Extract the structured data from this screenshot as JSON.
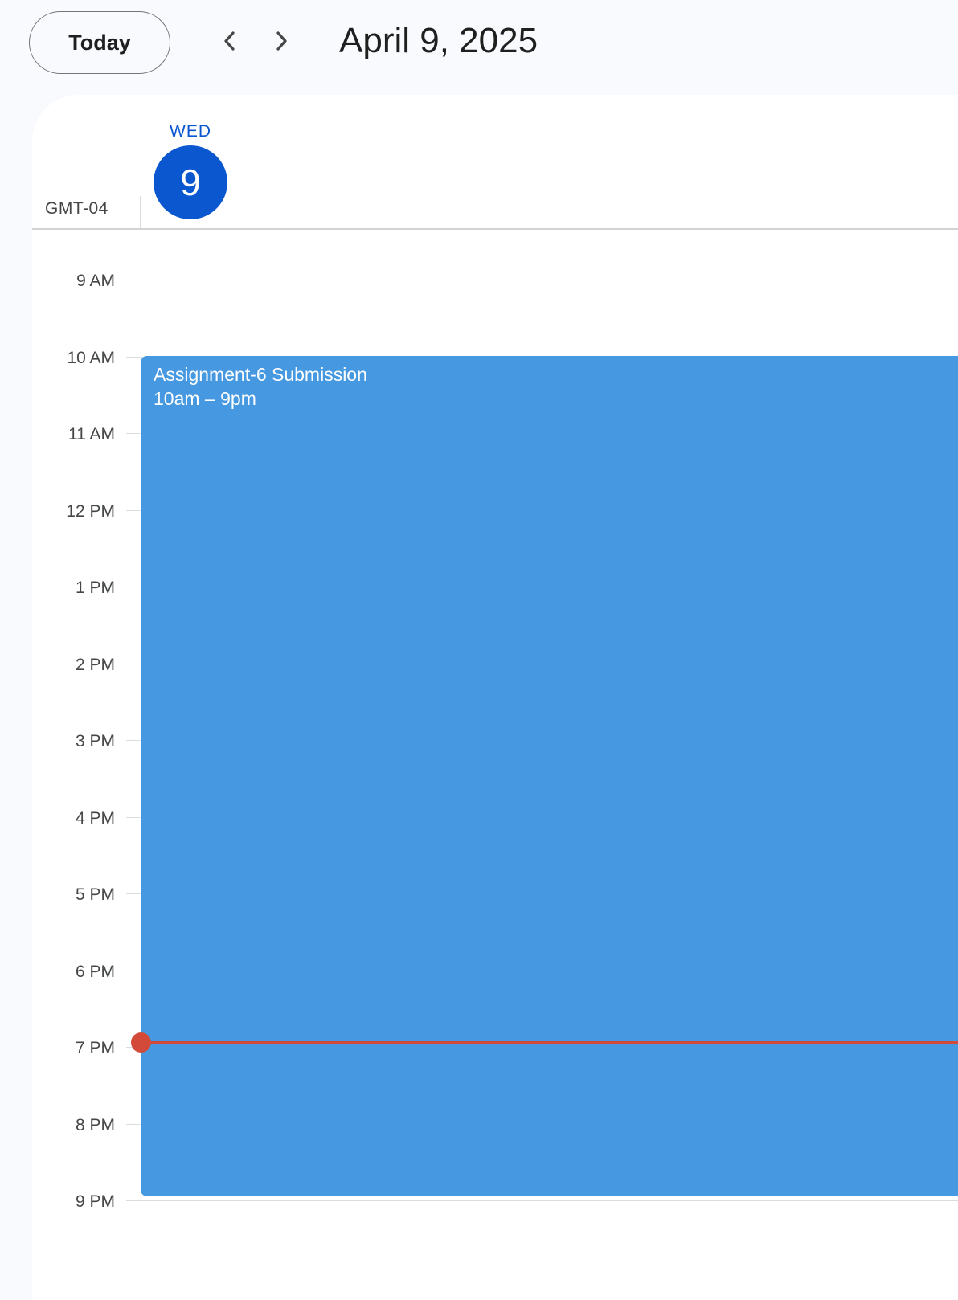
{
  "toolbar": {
    "today_label": "Today",
    "prev_icon": "chevron-left-icon",
    "next_icon": "chevron-right-icon",
    "date_title": "April 9, 2025"
  },
  "day_header": {
    "day_name": "WED",
    "day_number": "9",
    "timezone": "GMT-04"
  },
  "hours": [
    "9 AM",
    "10 AM",
    "11 AM",
    "12 PM",
    "1 PM",
    "2 PM",
    "3 PM",
    "4 PM",
    "5 PM",
    "6 PM",
    "7 PM",
    "8 PM",
    "9 PM"
  ],
  "event": {
    "title": "Assignment-6 Submission",
    "time": "10am – 9pm",
    "color": "#4699e0"
  },
  "colors": {
    "accent": "#0b57d0",
    "now_indicator": "#d44a3a"
  }
}
